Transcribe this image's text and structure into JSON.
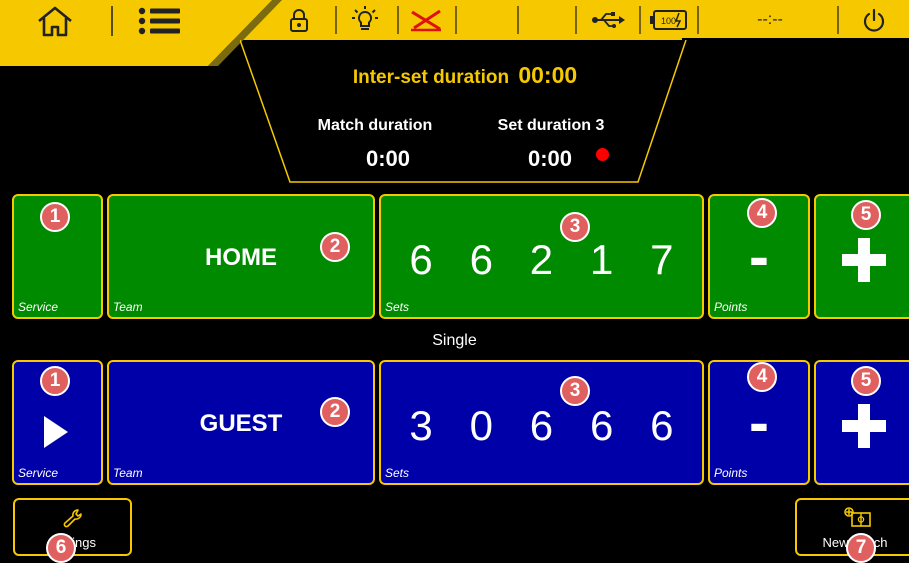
{
  "topbar": {
    "home_icon": "home-icon",
    "menu_icon": "menu-icon",
    "status_icons": [
      "lock-icon",
      "bulb-icon",
      "horn-muted-icon",
      "usb-icon",
      "battery-icon"
    ],
    "clock": "--:--",
    "power_icon": "power-icon"
  },
  "timers": {
    "inter_set_label": "Inter-set duration",
    "inter_set_value": "00:00",
    "match_label": "Match duration",
    "match_value": "0:00",
    "set_label": "Set duration 3",
    "set_value": "0:00"
  },
  "home": {
    "name": "HOME",
    "sets": [
      "6",
      "6",
      "2",
      "1",
      "7"
    ],
    "has_service": false,
    "color": "#008a00"
  },
  "guest": {
    "name": "GUEST",
    "sets": [
      "3",
      "0",
      "6",
      "6",
      "6"
    ],
    "has_service": true,
    "color": "#0000a8"
  },
  "captions": {
    "service": "Service",
    "team": "Team",
    "sets": "Sets",
    "points": "Points"
  },
  "controls": {
    "minus": "-",
    "plus": "+"
  },
  "mode": "Single",
  "bottom": {
    "settings_label": "Settings",
    "new_match_label": "New match"
  },
  "badges": {
    "service": "1",
    "team": "2",
    "sets": "3",
    "minus": "4",
    "plus": "5",
    "settings": "6",
    "new_match": "7"
  },
  "colors": {
    "accent": "#f5c800",
    "badge": "#e06060",
    "recording_dot": "#ff0000"
  }
}
